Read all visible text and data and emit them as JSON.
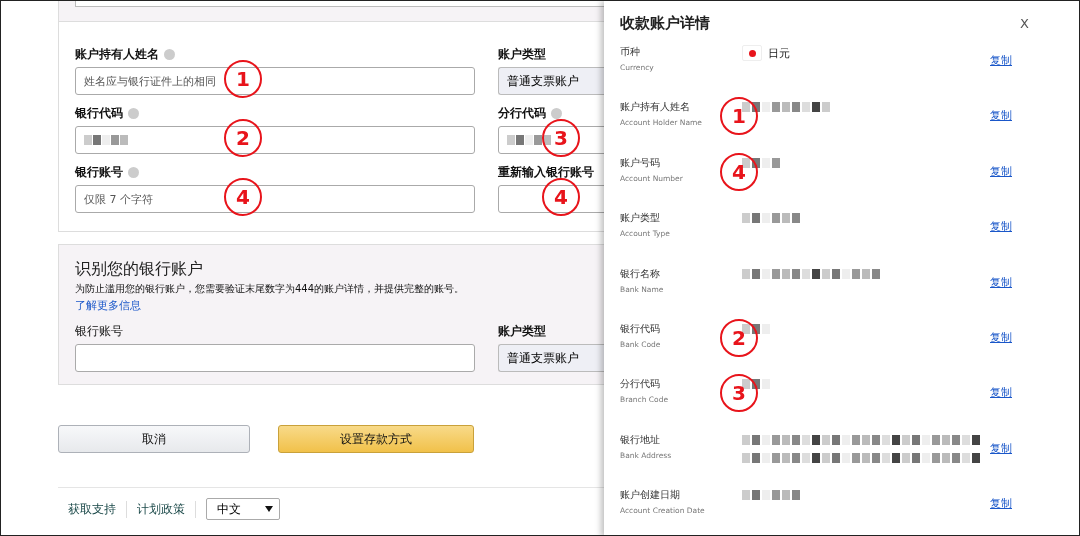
{
  "form": {
    "rows": [
      {
        "left": {
          "label": "账户持有人姓名",
          "help": true,
          "kind": "text",
          "placeholder": "姓名应与银行证件上的相同",
          "annotation": "1"
        },
        "right": {
          "label": "账户类型",
          "kind": "select",
          "value": "普通支票账户"
        }
      },
      {
        "left": {
          "label": "银行代码",
          "help": true,
          "kind": "redacted",
          "annotation": "2"
        },
        "right": {
          "label": "分行代码",
          "help": true,
          "kind": "redacted",
          "annotation": "3"
        }
      },
      {
        "left": {
          "label": "银行账号",
          "help": true,
          "kind": "text",
          "placeholder": "仅限 7 个字符",
          "annotation": "4"
        },
        "right": {
          "label": "重新输入银行账号",
          "kind": "text",
          "annotation": "4"
        }
      }
    ]
  },
  "verify": {
    "title": "识别您的银行账户",
    "description": "为防止滥用您的银行账户，您需要验证末尾数字为444的账户详情，并提供完整的账号。",
    "link": "了解更多信息",
    "left": {
      "label": "银行账号",
      "kind": "text"
    },
    "right": {
      "label": "账户类型",
      "kind": "select",
      "value": "普通支票账户"
    }
  },
  "buttons": [
    {
      "label": "取消",
      "kind": "secondary"
    },
    {
      "label": "设置存款方式",
      "kind": "primary"
    }
  ],
  "footer": {
    "links": [
      "获取支持",
      "计划政策"
    ],
    "language": "中文"
  },
  "panel": {
    "title": "收款账户详情",
    "close": "X",
    "rows": [
      {
        "label": "币种",
        "english": "Currency",
        "kind": "currency",
        "value": "日元",
        "copy": "复制"
      },
      {
        "label": "账户持有人姓名",
        "english": "Account Holder Name",
        "kind": "redacted",
        "annotation": "1",
        "copy": "复制"
      },
      {
        "label": "账户号码",
        "english": "Account Number",
        "kind": "redacted",
        "annotation": "4",
        "copy": "复制"
      },
      {
        "label": "账户类型",
        "english": "Account Type",
        "kind": "redacted",
        "copy": "复制"
      },
      {
        "label": "银行名称",
        "english": "Bank Name",
        "kind": "redacted",
        "copy": "复制"
      },
      {
        "label": "银行代码",
        "english": "Bank Code",
        "kind": "redacted",
        "annotation": "2",
        "copy": "复制"
      },
      {
        "label": "分行代码",
        "english": "Branch Code",
        "kind": "redacted",
        "annotation": "3",
        "copy": "复制"
      },
      {
        "label": "银行地址",
        "english": "Bank Address",
        "kind": "redacted",
        "copy": "复制"
      },
      {
        "label": "账户创建日期",
        "english": "Account Creation Date",
        "kind": "redacted",
        "copy": "复制"
      }
    ]
  }
}
